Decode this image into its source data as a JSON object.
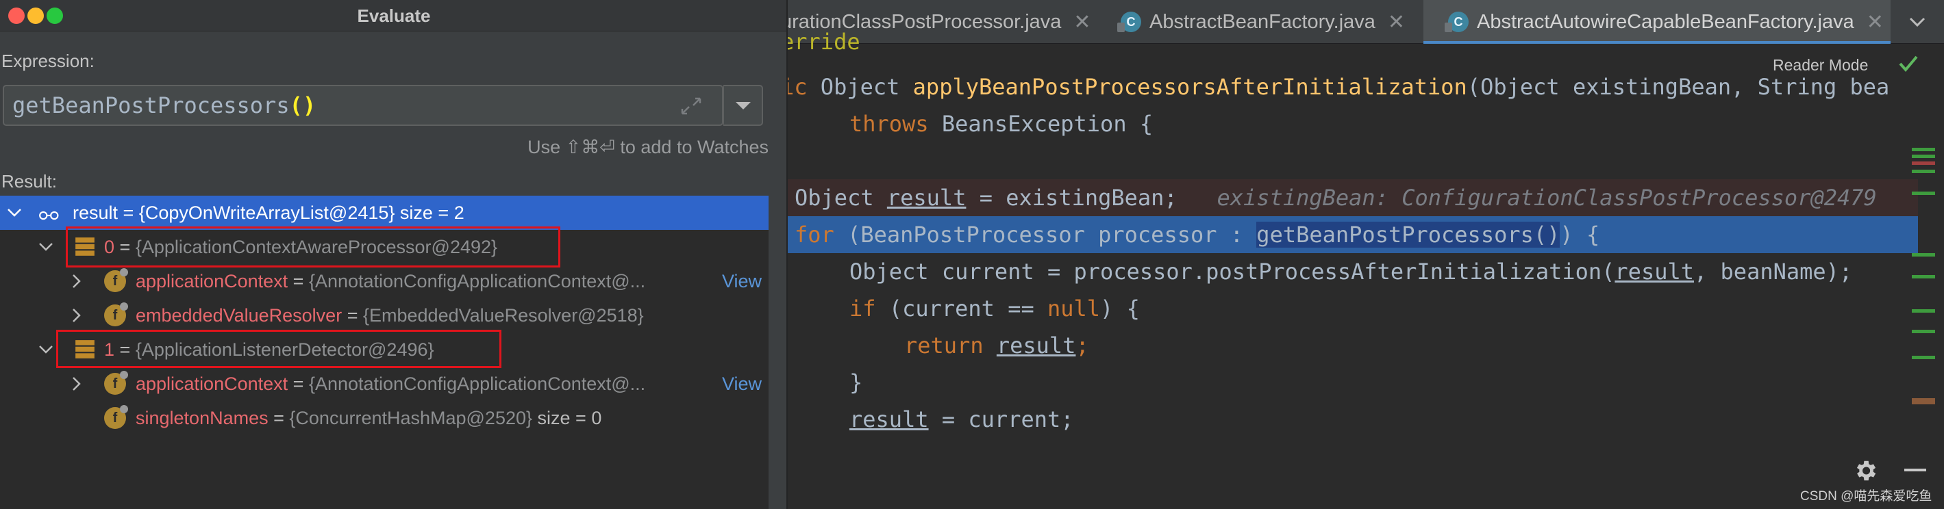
{
  "editor": {
    "tabs": [
      {
        "label": "urationClassPostProcessor.java",
        "active": false
      },
      {
        "label": "AbstractBeanFactory.java",
        "active": false
      },
      {
        "label": "AbstractAutowireCapableBeanFactory.java",
        "active": true
      }
    ],
    "reader_mode": "Reader Mode",
    "code": {
      "l0": "erride",
      "l1_kw": "ic",
      "l1_type": " Object ",
      "l1_fn": "applyBeanPostProcessorsAfterInitialization",
      "l1_rest": "(Object existingBean, String bea",
      "l2_kw": "throws",
      "l2_rest": " BeansException {",
      "l3_a": "Object ",
      "l3_var": "result",
      "l3_b": " = existingBean;",
      "l3_hint": "existingBean: ConfigurationClassPostProcessor@2479",
      "l4_kw": "for",
      "l4_a": " (BeanPostProcessor processor : ",
      "l4_hl": "getBeanPostProcessors()",
      "l4_b": ") {",
      "l5_a": "Object current = processor.postProcessAfterInitialization(",
      "l5_var": "result",
      "l5_b": ", beanName);",
      "l6_kw": "if",
      "l6_a": " (current == ",
      "l6_null": "null",
      "l6_b": ") {",
      "l7_kw": "return",
      "l7_sp": " ",
      "l7_var": "result",
      "l7_b": ";",
      "l8": "}",
      "l9_var": "result",
      "l9_b": " = current;"
    },
    "watermark": "CSDN @喵先森爱吃鱼"
  },
  "dialog": {
    "title": "Evaluate",
    "expression_label": "Expression:",
    "expression_name": "getBeanPostProcessors",
    "expression_parens": "()",
    "watch_hint": "Use ⇧⌘⏎ to add to Watches",
    "result_label": "Result:",
    "tree": {
      "result": {
        "name": "result",
        "eq": " = ",
        "value": "{CopyOnWriteArrayList@2415}",
        "extra": "  size = 2"
      },
      "item0": {
        "name": "0",
        "eq": " = ",
        "value": "{ApplicationContextAwareProcessor@2492}"
      },
      "item0_field1": {
        "name": "applicationContext",
        "eq": " = ",
        "value": "{AnnotationConfigApplicationContext@...",
        "link": "View"
      },
      "item0_field2": {
        "name": "embeddedValueResolver",
        "eq": " = ",
        "value": "{EmbeddedValueResolver@2518}"
      },
      "item1": {
        "name": "1",
        "eq": " = ",
        "value": "{ApplicationListenerDetector@2496}"
      },
      "item1_field1": {
        "name": "applicationContext",
        "eq": " = ",
        "value": "{AnnotationConfigApplicationContext@...",
        "link": "View"
      },
      "item1_field2": {
        "name": "singletonNames",
        "eq": " = ",
        "value": "{ConcurrentHashMap@2520}",
        "extra": "  size = 0"
      }
    }
  },
  "icons": {
    "traffic_lights": [
      "close-light",
      "minimize-light",
      "maximize-light"
    ],
    "field": "f"
  },
  "colors": {
    "keyword": "#cc7832",
    "method": "#ffc66d",
    "selection": "#2f65ca",
    "highlight_box": "#e0141c",
    "field_name": "#e8696e"
  }
}
